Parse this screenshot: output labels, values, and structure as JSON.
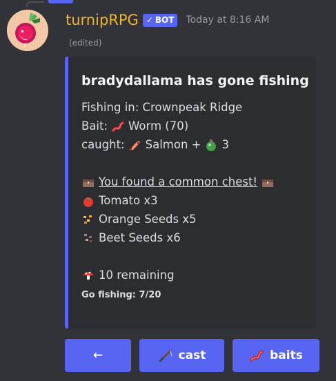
{
  "message": {
    "username": "turnipRPG",
    "bot_tag": "BOT",
    "timestamp": "Today at 8:16 AM",
    "edited": "(edited)"
  },
  "embed": {
    "title": "bradydallama has gone fishing",
    "fishing_in": "Fishing in: Crownpeak Ridge",
    "bait_label": "Bait:",
    "bait_value": "Worm (70)",
    "caught_label": "caught:",
    "caught_value": "Salmon +",
    "caught_count": "3",
    "chest_text": " You found a common chest! ",
    "items": [
      "Tomato x3",
      "Orange Seeds x5",
      "Beet Seeds x6"
    ],
    "remaining": "10 remaining",
    "footer": "Go fishing: 7/20"
  },
  "buttons": {
    "back_label": "←",
    "cast_label": "cast",
    "baits_label": "baits"
  },
  "colors": {
    "background": "#313338",
    "embed_bg": "#2b2d31",
    "accent": "#5865f2",
    "username": "#f0b232"
  }
}
